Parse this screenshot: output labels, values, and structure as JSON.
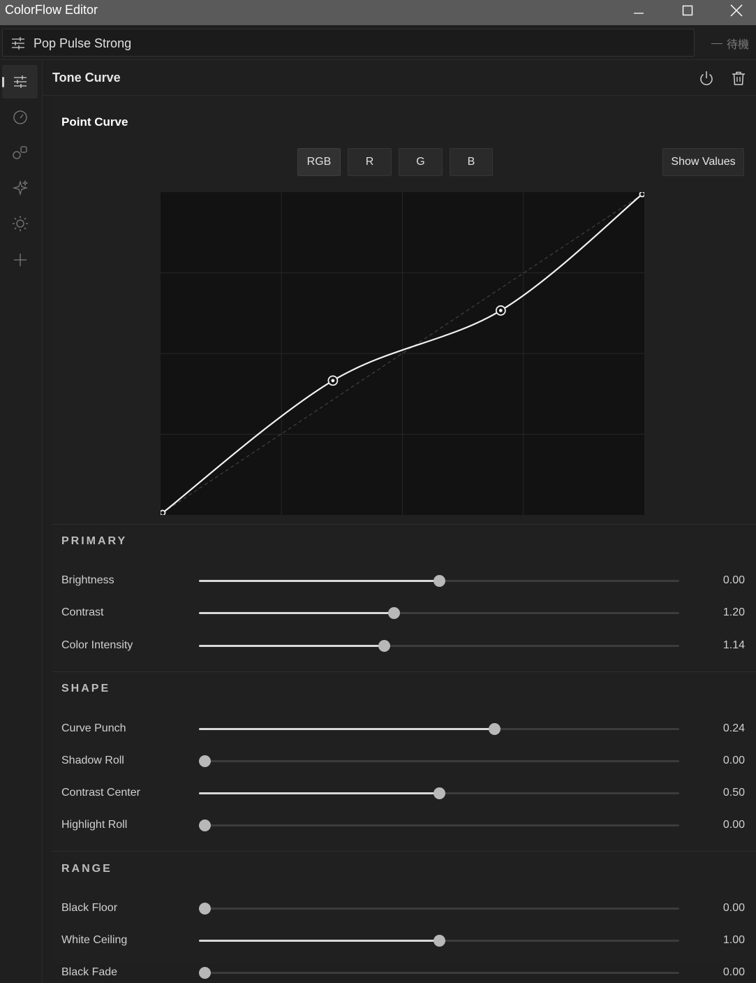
{
  "window": {
    "title": "ColorFlow Editor"
  },
  "preset": {
    "name": "Pop Pulse Strong",
    "status": "待機"
  },
  "sidebar": {
    "items": [
      {
        "icon": "sliders-icon",
        "active": true
      },
      {
        "icon": "gauge-icon",
        "active": false
      },
      {
        "icon": "shapes-icon",
        "active": false
      },
      {
        "icon": "sparkle-icon",
        "active": false
      },
      {
        "icon": "sun-icon",
        "active": false
      },
      {
        "icon": "plus-icon",
        "active": false
      }
    ]
  },
  "panel": {
    "title": "Tone Curve",
    "point_curve": {
      "title": "Point Curve",
      "channels": [
        "RGB",
        "R",
        "G",
        "B"
      ],
      "active_channel": "RGB",
      "show_values_label": "Show Values",
      "points": [
        [
          0,
          0
        ],
        [
          0.355,
          0.415
        ],
        [
          0.705,
          0.635
        ],
        [
          1,
          1
        ]
      ]
    }
  },
  "groups": [
    {
      "title": "PRIMARY",
      "sliders": [
        {
          "label": "Brightness",
          "value": "0.00",
          "fraction": 0.5
        },
        {
          "label": "Contrast",
          "value": "1.20",
          "fraction": 0.403
        },
        {
          "label": "Color Intensity",
          "value": "1.14",
          "fraction": 0.383
        }
      ]
    },
    {
      "title": "SHAPE",
      "sliders": [
        {
          "label": "Curve Punch",
          "value": "0.24",
          "fraction": 0.618
        },
        {
          "label": "Shadow Roll",
          "value": "0.00",
          "fraction": 0.0
        },
        {
          "label": "Contrast Center",
          "value": "0.50",
          "fraction": 0.5
        },
        {
          "label": "Highlight Roll",
          "value": "0.00",
          "fraction": 0.0
        }
      ]
    },
    {
      "title": "RANGE",
      "sliders": [
        {
          "label": "Black Floor",
          "value": "0.00",
          "fraction": 0.0
        },
        {
          "label": "White Ceiling",
          "value": "1.00",
          "fraction": 0.5
        },
        {
          "label": "Black Fade",
          "value": "0.00",
          "fraction": 0.0
        }
      ]
    }
  ]
}
